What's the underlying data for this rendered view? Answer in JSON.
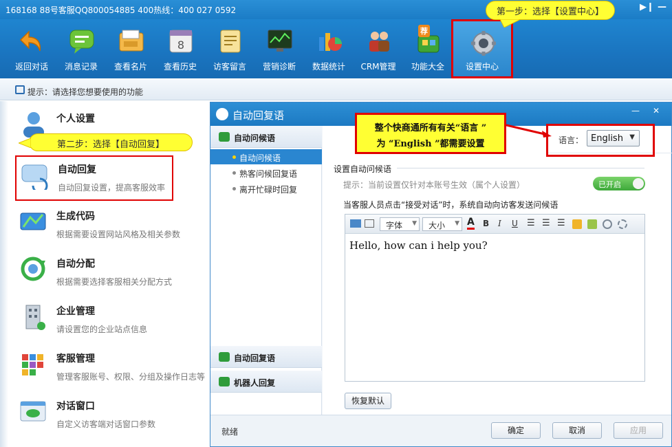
{
  "titlebar": {
    "hotline": "168168 88号客服QQ800054885  400热线：400 027 0592"
  },
  "toolbar": {
    "items": [
      {
        "label": "返回对话",
        "icon": "back-arrow-icon"
      },
      {
        "label": "消息记录",
        "icon": "chat-bubble-icon"
      },
      {
        "label": "查看名片",
        "icon": "business-card-icon"
      },
      {
        "label": "查看历史",
        "icon": "calendar-icon"
      },
      {
        "label": "访客留言",
        "icon": "note-icon"
      },
      {
        "label": "营销诊断",
        "icon": "monitor-chart-icon"
      },
      {
        "label": "数据统计",
        "icon": "stats-chart-icon"
      },
      {
        "label": "CRM管理",
        "icon": "people-icon"
      },
      {
        "label": "功能大全",
        "icon": "toolbox-icon",
        "badge": "荐"
      },
      {
        "label": "设置中心",
        "icon": "gear-icon"
      }
    ]
  },
  "callouts": {
    "step1": "第一步：选择【设置中心】",
    "step2": "第二步：选择【自动回复】",
    "lang_note_line1": "整个快商通所有有关“语言 ”",
    "lang_note_line2": "为 “English ”都需要设置"
  },
  "hint": {
    "text": "提示：请选择您想要使用的功能"
  },
  "left_items": [
    {
      "title": "个人设置",
      "desc": "",
      "icon": "person-icon"
    },
    {
      "title": "自动回复",
      "desc": "自动回复设置，提高客服效率",
      "icon": "auto-reply-icon"
    },
    {
      "title": "生成代码",
      "desc": "根据需要设置网站风格及相关参数",
      "icon": "code-screen-icon"
    },
    {
      "title": "自动分配",
      "desc": "根据需要选择客服相关分配方式",
      "icon": "distribute-icon"
    },
    {
      "title": "企业管理",
      "desc": "请设置您的企业站点信息",
      "icon": "building-icon"
    },
    {
      "title": "客服管理",
      "desc": "管理客服账号、权限、分组及操作日志等",
      "icon": "grid-manage-icon"
    },
    {
      "title": "对话窗口",
      "desc": "自定义访客端对话窗口参数",
      "icon": "chat-window-icon"
    }
  ],
  "dialog": {
    "title": "自动回复语",
    "section_headers": [
      "自动问候语",
      "自动回复语",
      "机器人回复"
    ],
    "sub_items": [
      "自动问候语",
      "熟客问候回复语",
      "离开忙碌时回复"
    ],
    "lang_label": "语言：",
    "lang_value": "English",
    "group_title": "设置自动问候语",
    "tip": "提示：当前设置仅针对本账号生效（属个人设置）",
    "toggle": "已开启",
    "editor_label": "当客服人员点击“接受对话”时，系统自动向访客发送问候语",
    "font_select": "字体",
    "size_select": "大小",
    "editor_text": "Hello, how can i help you?",
    "reset_btn": "恢复默认",
    "status": "就绪",
    "ok": "确定",
    "cancel": "取消",
    "apply": "应用"
  }
}
